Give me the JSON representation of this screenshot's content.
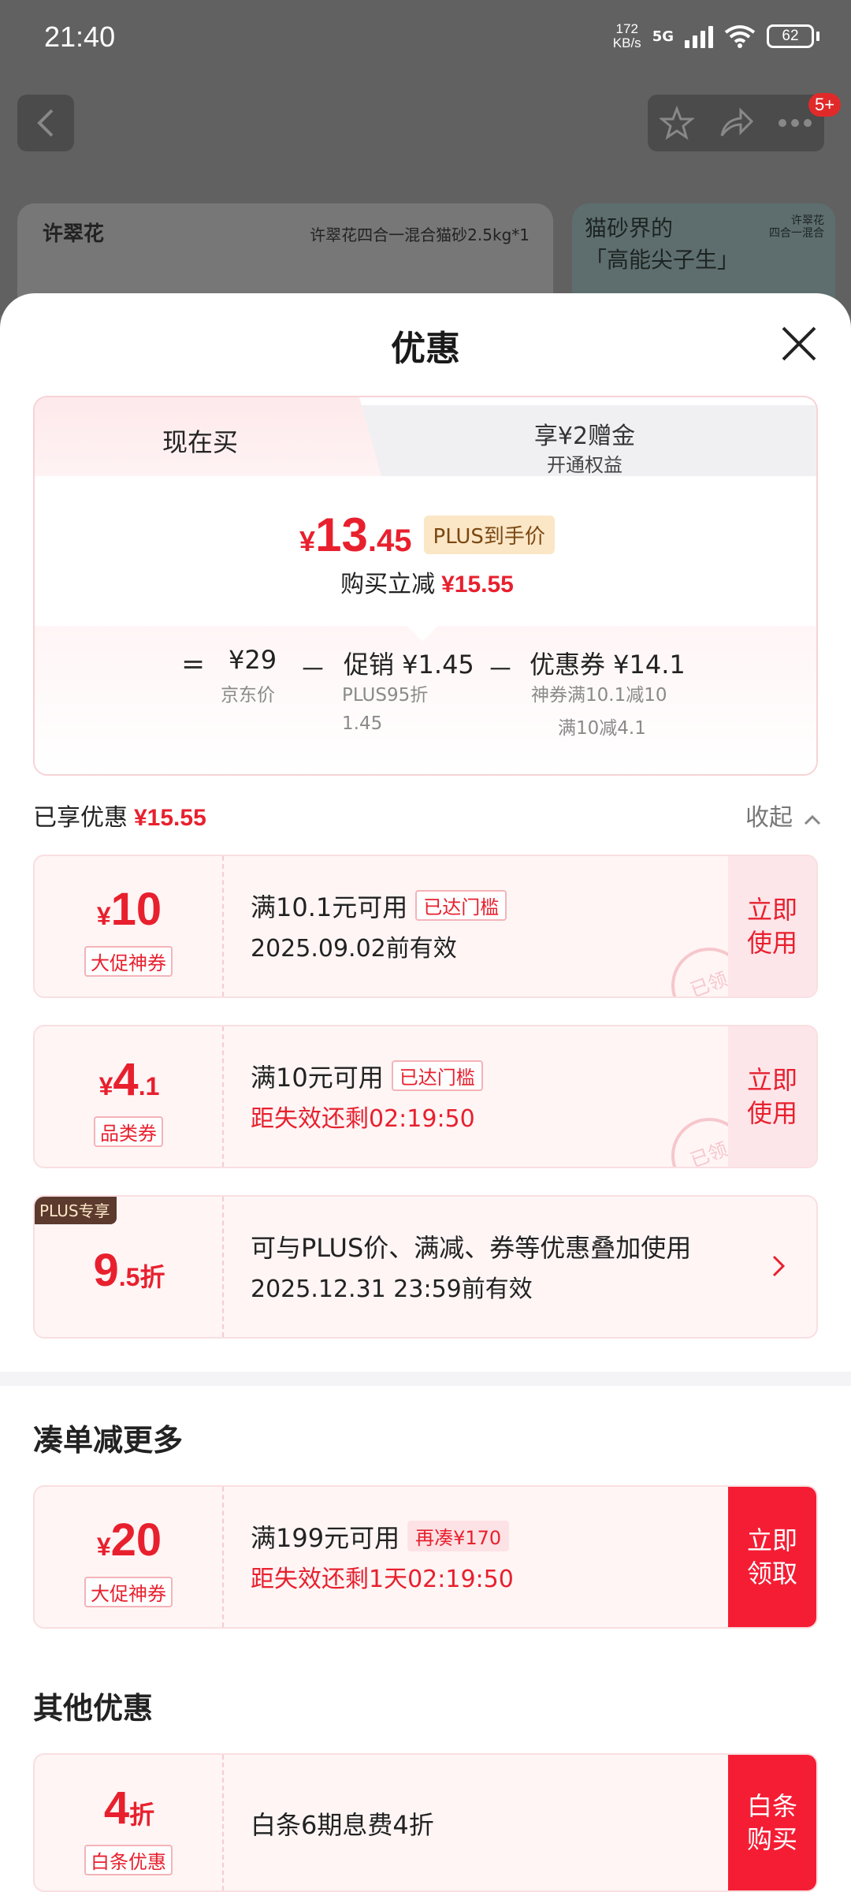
{
  "status": {
    "time": "21:40",
    "speed_top": "172",
    "speed_bottom": "KB/s",
    "network": "5G",
    "battery": "62"
  },
  "header": {
    "notif_badge": "5+"
  },
  "background_cards": {
    "brand": "许翠花",
    "product": "许翠花四合一混合猫砂2.5kg*1",
    "promo_title_1": "猫砂界的",
    "promo_title_2": "「高能尖子生」",
    "promo_side_1": "许翠花",
    "promo_side_2": "四合一混合"
  },
  "sheet": {
    "title": "优惠"
  },
  "tabs": {
    "now": "现在买",
    "plus_title": "享¥2赠金",
    "plus_sub": "开通权益"
  },
  "price": {
    "yen": "¥",
    "int": "13",
    "dec": ".45",
    "tag": "PLUS到手价",
    "cut_label": "购买立减",
    "cut_value": "¥15.55"
  },
  "calc": {
    "eq": "=",
    "base": "¥29",
    "base_label": "京东价",
    "minus": "－",
    "promo": "促销 ¥1.45",
    "promo_sub1": "PLUS95折",
    "promo_sub2": "1.45",
    "coupon": "优惠券 ¥14.1",
    "coupon_sub1": "神券满10.1减10",
    "coupon_sub2": "满10减4.1"
  },
  "enjoyed": {
    "label": "已享优惠",
    "value": "¥15.55",
    "collapse": "收起"
  },
  "coupons": [
    {
      "yen": "¥",
      "num": "10",
      "dec": "",
      "tag": "大促神券",
      "line1": "满10.1元可用",
      "threshold": "已达门槛",
      "line2": "2025.09.02前有效",
      "action": "立即使用",
      "stamp": "已领"
    },
    {
      "yen": "¥",
      "num": "4",
      "dec": ".1",
      "tag": "品类券",
      "line1": "满10元可用",
      "threshold": "已达门槛",
      "line2": "距失效还剩02:19:50",
      "action": "立即使用",
      "stamp": "已领"
    }
  ],
  "plus_discount": {
    "badge": "PLUS专享",
    "num": "9",
    "dec": ".5折",
    "line1": "可与PLUS价、满减、券等优惠叠加使用",
    "line2": "2025.12.31 23:59前有效"
  },
  "more": {
    "title": "凑单减更多",
    "yen": "¥",
    "num": "20",
    "tag": "大促神券",
    "line1": "满199元可用",
    "threshold": "再凑¥170",
    "line2": "距失效还剩1天02:19:50",
    "action": "立即领取"
  },
  "other": {
    "title": "其他优惠",
    "num": "4",
    "unit": "折",
    "tag": "白条优惠",
    "line1": "白条6期息费4折",
    "action": "白条购买"
  },
  "colors": {
    "accent": "#e8202e",
    "solid_button": "#f51d34",
    "plus_tag_bg": "#fbe6c6"
  }
}
